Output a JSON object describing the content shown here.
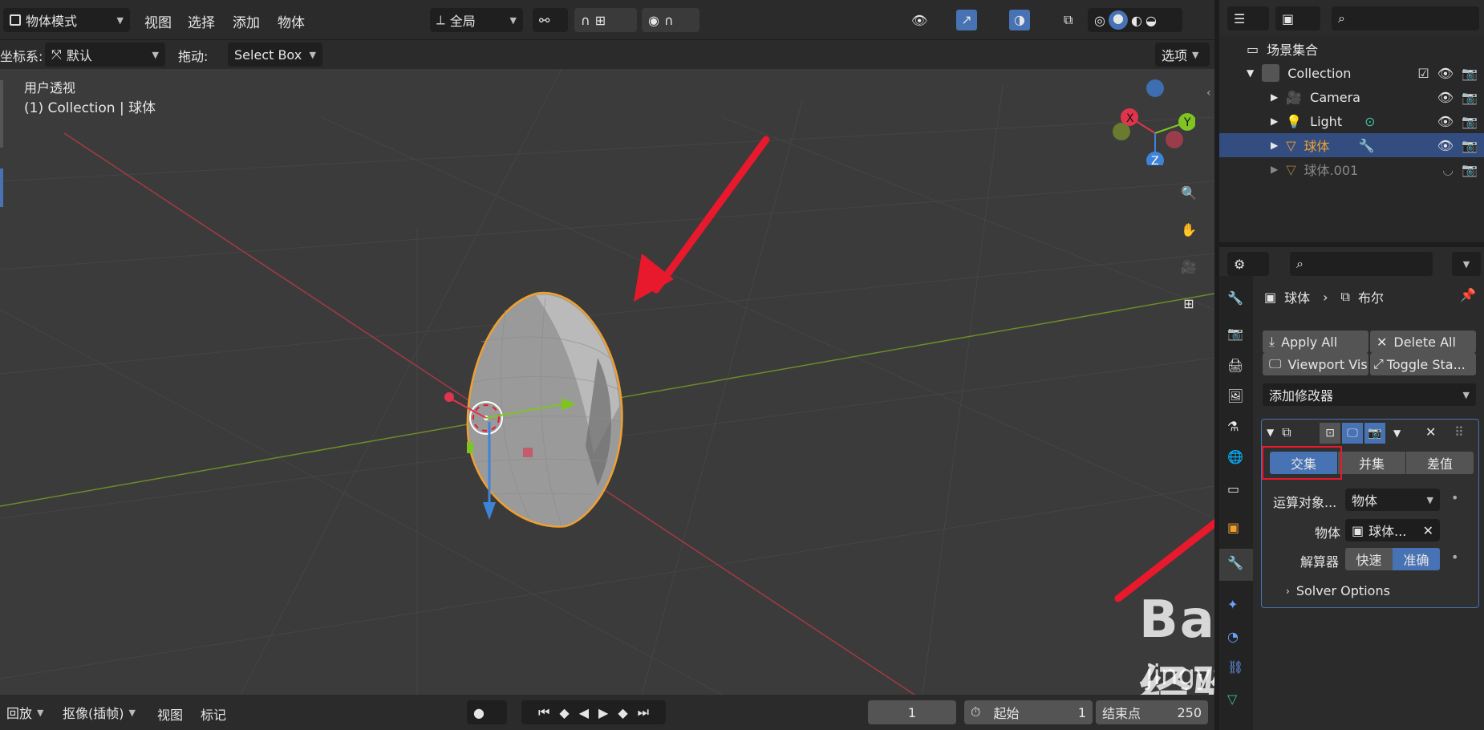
{
  "header": {
    "mode_label": "物体模式",
    "menu": [
      "视图",
      "选择",
      "添加",
      "物体"
    ],
    "transform_orientation": "全局",
    "coord_label": "坐标系:",
    "coord_value": "默认",
    "drag_label": "拖动:",
    "drag_value": "Select Box",
    "options_label": "选项"
  },
  "viewport": {
    "view_name": "用户透视",
    "object_info": "(1) Collection | 球体",
    "gizmo_axes": [
      "X",
      "Y",
      "Z"
    ]
  },
  "outliner": {
    "rows": [
      {
        "label": "场景集合",
        "type": "scene"
      },
      {
        "label": "Collection",
        "type": "collection"
      },
      {
        "label": "Camera",
        "type": "camera"
      },
      {
        "label": "Light",
        "type": "light"
      },
      {
        "label": "球体",
        "type": "mesh",
        "selected": true
      },
      {
        "label": "球体.001",
        "type": "mesh",
        "dimmed": true
      }
    ]
  },
  "properties": {
    "breadcrumb": {
      "object": "球体",
      "modifier": "布尔"
    },
    "apply_all": "Apply All",
    "delete_all": "Delete All",
    "viewport_vis": "Viewport Vis",
    "toggle_stack": "Toggle Sta...",
    "add_modifier": "添加修改器",
    "operations": [
      "交集",
      "并集",
      "差值"
    ],
    "active_operation": "交集",
    "operand_label": "运算对象...",
    "operand_value": "物体",
    "object_label": "物体",
    "object_value": "球体...",
    "solver_label": "解算器",
    "solver_fast": "快速",
    "solver_exact": "准确",
    "solver_options": "Solver Options"
  },
  "timeline": {
    "playback": "回放",
    "keying": "抠像(插帧)",
    "view": "视图",
    "marker": "标记",
    "current_frame": "1",
    "start_label": "起始",
    "start_value": "1",
    "end_label": "结束点",
    "end_value": "250"
  },
  "watermark": {
    "brand": "Baidu经验",
    "url": "jingyan.baidu.com"
  },
  "colors": {
    "accent": "#4772b3",
    "selection_orange": "#f0a030",
    "annotation_red": "#e8192c"
  }
}
